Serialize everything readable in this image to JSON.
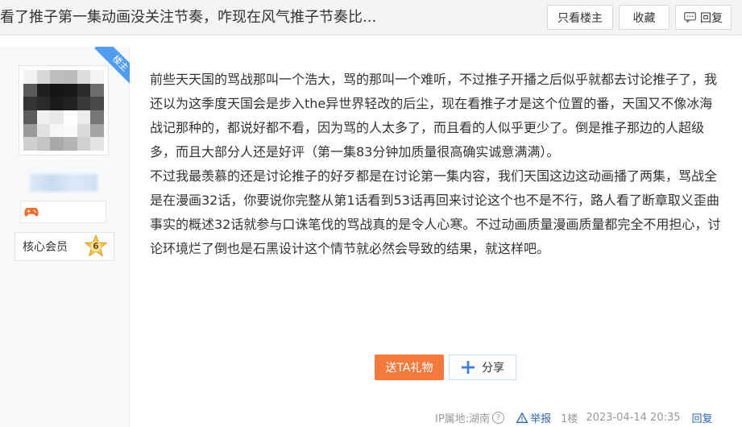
{
  "header": {
    "title": "看了推子第一集动画没关注节奏，咋现在风气推子节奏比...",
    "only_op_label": "只看楼主",
    "favorite_label": "收藏",
    "reply_label": "回复"
  },
  "user": {
    "op_tag": "楼主",
    "member_label": "核心会员",
    "level": "6",
    "badge_icon": "gamepad-icon"
  },
  "post": {
    "paragraphs": [
      "前些天天国的骂战那叫一个浩大，骂的那叫一个难听，不过推子开播之后似乎就都去讨论推子了，我还以为这季度天国会是步入the异世界轻改的后尘，现在看推子才是这个位置的番，天国又不像冰海战记那种的，都说好都不看，因为骂的人太多了，而且看的人似乎更少了。倒是推子那边的人超级多，而且大部分人还是好评（第一集83分钟加质量很高确实诚意满满）。",
      "不过我最羡慕的还是讨论推子的好歹都是在讨论第一集内容，我们天国这边这动画播了两集，骂战全是在漫画32话，你要说你完整从第1话看到53话再回来讨论这个也不是不行，路人看了断章取义歪曲事实的概述32话就参与口诛笔伐的骂战真的是令人心寒。不过动画质量漫画质量都完全不用担心，讨论环境烂了倒也是石黑设计这个情节就必然会导致的结果，就这样吧。"
    ]
  },
  "actions": {
    "gift_label": "送TA礼物",
    "share_label": "分享"
  },
  "meta": {
    "ip_location": "IP属地:湖南",
    "report_label": "举报",
    "floor": "1楼",
    "timestamp": "2023-04-14 20:35",
    "reply_label": "回复"
  },
  "colors": {
    "accent_blue": "#2d64b3",
    "gift_orange": "#f47a3c",
    "op_ribbon": "#4f9cf0"
  }
}
